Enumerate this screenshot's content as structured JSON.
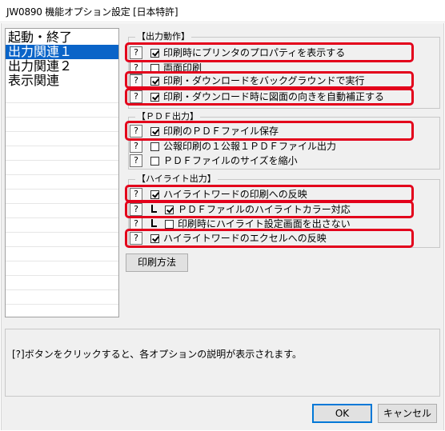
{
  "window": {
    "title": "JW0890 機能オプション設定 [日本特許]"
  },
  "sidebar": {
    "items": [
      {
        "label": "起動・終了",
        "selected": false
      },
      {
        "label": "出力関連１",
        "selected": true
      },
      {
        "label": "出力関連２",
        "selected": false
      },
      {
        "label": "表示関連",
        "selected": false
      }
    ]
  },
  "groups": {
    "output_action": {
      "title": "【出力動作】",
      "options": [
        {
          "help": "?",
          "checked": true,
          "label": "印刷時にプリンタのプロパティを表示する",
          "highlighted": true
        },
        {
          "help": "?",
          "checked": false,
          "label": "両面印刷",
          "highlighted": false
        },
        {
          "help": "?",
          "checked": true,
          "label": "印刷・ダウンロードをバックグラウンドで実行",
          "highlighted": true
        },
        {
          "help": "?",
          "checked": true,
          "label": "印刷・ダウンロード時に図面の向きを自動補正する",
          "highlighted": true
        }
      ]
    },
    "pdf_output": {
      "title": "【ＰＤＦ出力】",
      "options": [
        {
          "help": "?",
          "checked": true,
          "label": "印刷のＰＤＦファイル保存",
          "highlighted": true
        },
        {
          "help": "?",
          "checked": false,
          "label": "公報印刷の１公報１ＰＤＦファイル出力",
          "highlighted": false
        },
        {
          "help": "?",
          "checked": false,
          "label": "ＰＤＦファイルのサイズを縮小",
          "highlighted": false
        }
      ]
    },
    "highlight_output": {
      "title": "【ハイライト出力】",
      "options": [
        {
          "help": "?",
          "checked": true,
          "label": "ハイライトワードの印刷への反映",
          "highlighted": true
        },
        {
          "help": "?",
          "checked": true,
          "label": "ＰＤＦファイルのハイライトカラー対応",
          "highlighted": true,
          "tree": true
        },
        {
          "help": "?",
          "checked": false,
          "label": "印刷時にハイライト設定画面を出さない",
          "highlighted": false,
          "tree": true
        },
        {
          "help": "?",
          "checked": true,
          "label": "ハイライトワードのエクセルへの反映",
          "highlighted": true
        }
      ]
    }
  },
  "print_method_button": "印刷方法",
  "info_text": "[?]ボタンをクリックすると、各オプションの説明が表示されます。",
  "footer": {
    "ok_label": "OK",
    "cancel_label": "キャンセル"
  },
  "colors": {
    "highlight": "#e3001b",
    "selection": "#0a64c8",
    "background": "#f0f0f0"
  }
}
